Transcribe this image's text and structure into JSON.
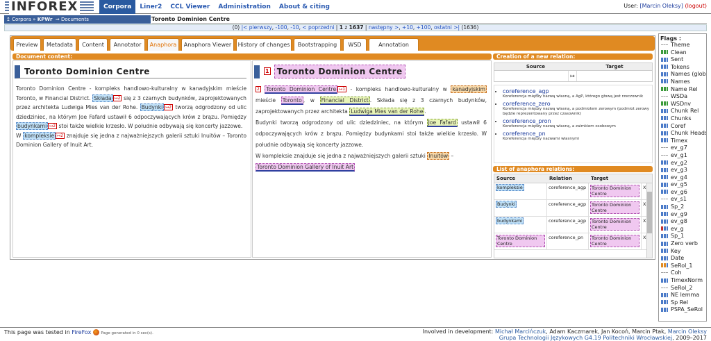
{
  "logo_text": "INFOREX",
  "menu": [
    "Corpora",
    "Liner2",
    "CCL Viewer",
    "Administration",
    "About & citing"
  ],
  "user": {
    "prefix": "User:",
    "name": "[Marcin Oleksy]",
    "logout": "(logout)"
  },
  "breadcrumb": {
    "corpora": "Corpora",
    "corpus": "KPWr",
    "documents": "Documents"
  },
  "doc_title": "Toronto Dominion Centre",
  "pager": {
    "zero": "(0)",
    "first": "|< pierwszy",
    "m100": "-100",
    "m10": "-10",
    "prev": "< poprzedni",
    "current": "1",
    "of": "z",
    "total": "1637",
    "next": "następny >",
    "p10": "+10",
    "p100": "+100",
    "last": "ostatni >|",
    "count": "(1636)"
  },
  "tabs": [
    "Preview",
    "Metadata",
    "Content",
    "Annotator",
    "Anaphora",
    "Anaphora Viewer",
    "History of changes",
    "Bootstrapping",
    "WSD",
    "Annotation lemmas"
  ],
  "active_tab": "Anaphora",
  "doc_content_label": "Document content:",
  "left_text": {
    "p1a": "Toronto Dominion Centre - kompleks handlowo-kulturalny w kanadyjskim mieście Toronto, w Financial District.",
    "w_skladasie": "Składa",
    "p1b": "się z 3 czarnych budynków, zaprojektowanych przez architekta Ludwiga Mies van der Rohe.",
    "w_budynki": "Budynki",
    "p2a": "tworzą odgrodzony od ulic dziedziniec, na którym Joe Fafard ustawił 6 odpoczywających krów z brązu. Pomiędzy",
    "w_budynkami": "budynkami",
    "p2b": "stoi także wielkie krzesło. W południe odbywają się koncerty jazzowe.",
    "w_W": "W",
    "w_kompleksie": "kompleksie",
    "p3": "znajduje się jedna z najważniejszych galerii sztuki Inuitów – Toronto Dominion Gallery of Inuit Art."
  },
  "right_text": {
    "title": "Toronto Dominion Centre",
    "num1": "1",
    "num2": "2",
    "toronto_dc": "Toronto Dominion Centre",
    "l1": "- kompleks handlowo-kulturalny w",
    "kanadyjskim": "kanadyjskim",
    "miescie": "mieście",
    "toronto": "Toronto",
    "w": ", w",
    "fd": "Financial District",
    "l2": ". Składa się z 3 czarnych budynków, zaprojektowanych przez architekta",
    "ludwiga": "Ludwiga Mies van der Rohe",
    "l3": "Budynki tworzą odgrodzony od ulic dziedziniec, na którym",
    "joe": "Joe Fafard",
    "l4": "ustawił 6 odpoczywających krów z brązu. Pomiędzy budynkami stoi także wielkie krzesło. W południe odbywają się koncerty jazzowe.",
    "l5": "W kompleksie znajduje się jedna z najważniejszych galerii sztuki",
    "inuitow": "Inuitów",
    "dash": "–",
    "gallery": "Toronto Dominion Gallery of Inuit Art"
  },
  "creation": {
    "label": "Creation of a new relation:",
    "source": "Source",
    "target": "Target",
    "arrow": "↦"
  },
  "relation_types": [
    {
      "name": "coreference_agp",
      "desc": "Koreferencja między nazwą własną, a AgP, którego głową jest rzeczownik"
    },
    {
      "name": "coreference_zero",
      "desc": "Koreferencja między nazwą własną, a podmiotem zerowym (podmiot zerowy będzie reprezentowany przez czasownik)"
    },
    {
      "name": "coreference_pron",
      "desc": "Koreferencja między nazwą własną, a zaimkiem osobowym"
    },
    {
      "name": "coreference_pn",
      "desc": "Koreferencja między nazwami własnymi"
    }
  ],
  "list_label": "List of anaphora relations:",
  "list_headers": {
    "source": "Source",
    "relation": "Relation",
    "target": "Target"
  },
  "relations": [
    {
      "source": "kompleksie",
      "relation": "coreference_agp",
      "target": "Toronto Dominion Centre",
      "x": "X"
    },
    {
      "source": "Budynki",
      "relation": "coreference_agp",
      "target": "Toronto Dominion Centre",
      "x": "X"
    },
    {
      "source": "budynkami",
      "relation": "coreference_agp",
      "target": "Toronto Dominion Centre",
      "x": "X"
    },
    {
      "source": "Toronto Dominion Centre",
      "relation": "coreference_pn",
      "target": "Toronto Dominion Centre",
      "x": "X"
    }
  ],
  "flags_title": "Flags :",
  "flags": [
    {
      "name": "Theme",
      "icon": "dash"
    },
    {
      "name": "Clean",
      "icon": "green"
    },
    {
      "name": "Sent",
      "icon": "blue"
    },
    {
      "name": "Tokens",
      "icon": "blue"
    },
    {
      "name": "Names (global)",
      "icon": "blue"
    },
    {
      "name": "Names",
      "icon": "blue"
    },
    {
      "name": "Name Rel",
      "icon": "green"
    },
    {
      "name": "WSDa",
      "icon": "dash"
    },
    {
      "name": "WSDnv",
      "icon": "green"
    },
    {
      "name": "Chunk Rel",
      "icon": "blue"
    },
    {
      "name": "Chunks",
      "icon": "blue"
    },
    {
      "name": "Coref",
      "icon": "blue"
    },
    {
      "name": "Chunk Heads",
      "icon": "blue"
    },
    {
      "name": "Timex",
      "icon": "blue"
    },
    {
      "name": "ev_g7",
      "icon": "dash"
    },
    {
      "name": "ev_g1",
      "icon": "dash"
    },
    {
      "name": "ev_g2",
      "icon": "blue"
    },
    {
      "name": "ev_g3",
      "icon": "blue"
    },
    {
      "name": "ev_g4",
      "icon": "blue"
    },
    {
      "name": "ev_g5",
      "icon": "blue"
    },
    {
      "name": "ev_g6",
      "icon": "blue"
    },
    {
      "name": "ev_s1",
      "icon": "dash"
    },
    {
      "name": "Sp_2",
      "icon": "blue"
    },
    {
      "name": "ev_g9",
      "icon": "blue"
    },
    {
      "name": "ev_g8",
      "icon": "blue"
    },
    {
      "name": "ev_g",
      "icon": "red"
    },
    {
      "name": "Sp_1",
      "icon": "blue"
    },
    {
      "name": "Zero verb",
      "icon": "blue"
    },
    {
      "name": "Key",
      "icon": "blue"
    },
    {
      "name": "Date",
      "icon": "blue"
    },
    {
      "name": "SeRol_1",
      "icon": "orange"
    },
    {
      "name": "Coh",
      "icon": "dash"
    },
    {
      "name": "TimexNorm",
      "icon": "blue"
    },
    {
      "name": "SeRol_2",
      "icon": "dash"
    },
    {
      "name": "NE lemma",
      "icon": "blue"
    },
    {
      "name": "Sp Rel",
      "icon": "blue"
    },
    {
      "name": "PSPA_SeRol",
      "icon": "blue"
    }
  ],
  "footer": {
    "tested": "This page was tested in",
    "firefox": "FireFox",
    "generated": "Page generated in 0 sec(s).",
    "involved": "Involved in development:",
    "dev1": "Michał Marcińczuk",
    "others": ", Adam Kaczmarek, Jan Kocoń, Marcin Ptak,",
    "dev2": "Marcin Oleksy",
    "group": "Grupa Technologii Językowych G4.19 Politechniki Wrocławskiej",
    "years": ", 2009–2017"
  }
}
